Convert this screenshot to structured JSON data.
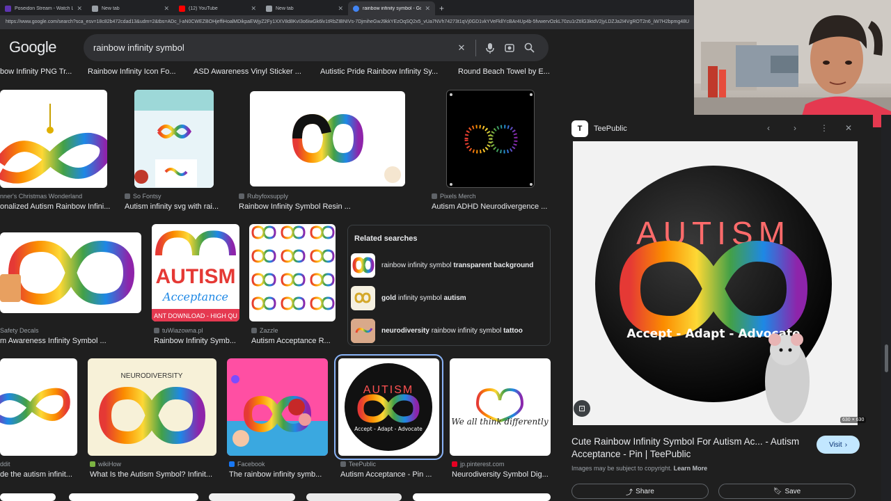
{
  "tabs": [
    {
      "title": "Poseidon Stream - Watch Live",
      "color": "#5e35b1"
    },
    {
      "title": "New tab",
      "color": "#9aa0a6"
    },
    {
      "title": "(12) YouTube",
      "color": "#ff0000"
    },
    {
      "title": "New tab",
      "color": "#9aa0a6"
    },
    {
      "title": "rainbow infinity symbol - Google",
      "color": "#4285f4",
      "active": true
    }
  ],
  "url": "https://www.google.com/search?sca_esv=18c82b472cdad13&udm=2&tbs=ADc_l-aN0CWEZBOHjeffiHoalMDikpaEWjyZ2Fy1XXV8d8KvI3o6iwGk6lv1tRbZIBNIVs-7DjmiheGwJ9kkYEzOqSQ2x5_vUa7NVh74273t1qVj0GD1vkYVeFkllYcBAr4Up4b-5fvwervOzkL70zu1rZtIlG3ktdV2jyLDZJa2I4VgROT2n6_iW7H2bpmg48U",
  "logo": "Google",
  "search": {
    "query": "rainbow infinity symbol"
  },
  "chips": [
    "bow Infinity PNG Tr...",
    "Rainbow Infinity Icon Fo...",
    "ASD Awareness Vinyl Sticker ...",
    "Autistic Pride Rainbow Infinity Sy...",
    "Round Beach Towel by E..."
  ],
  "row1": [
    {
      "source": "nner's Christmas Wonderland",
      "title": "onalized Autism Rainbow Infini..."
    },
    {
      "source": "So Fontsy",
      "title": "Autism infinity svg with rai..."
    },
    {
      "source": "Rubyfoxsupply",
      "title": "Rainbow Infinity Symbol Resin ..."
    },
    {
      "source": "Pixels Merch",
      "title": "Autism ADHD Neurodivergence ..."
    }
  ],
  "row2": [
    {
      "source": "Safety Decals",
      "title": "m Awareness Infinity Symbol ..."
    },
    {
      "source": "tuWiazowna.pl",
      "title": "Rainbow Infinity Symb..."
    },
    {
      "source": "Zazzle",
      "title": "Autism Acceptance R..."
    }
  ],
  "row2_images": {
    "autism_word": "AUTISM",
    "acceptance_word": "Acceptance",
    "banner": "ANT DOWNLOAD - HIGH QU"
  },
  "related": {
    "heading": "Related searches",
    "items": [
      {
        "plain": "rainbow infinity symbol ",
        "bold": "transparent background"
      },
      {
        "bold_pre": "gold",
        "plain": " infinity symbol ",
        "bold": "autism"
      },
      {
        "bold_pre": "neurodiversity",
        "plain": " rainbow infinity symbol ",
        "bold": "tattoo"
      }
    ]
  },
  "row3": [
    {
      "source": "ddit",
      "title": "de the autism infinit..."
    },
    {
      "source": "wikiHow",
      "title": "What Is the Autism Symbol? Infinit..."
    },
    {
      "source": "Facebook",
      "title": "The rainbow infinity symb..."
    },
    {
      "source": "TeePublic",
      "title": "Autism Acceptance - Pin ..."
    },
    {
      "source": "jp.pinterest.com",
      "title": "Neurodiversity Symbol Dig..."
    }
  ],
  "row3_images": {
    "neuro_label": "NEURODIVERSITY",
    "autism_pin": "AUTISM",
    "pin_slogan": "Accept - Adapt - Advocate",
    "think_text": "We all think differently"
  },
  "panel": {
    "site": "TeePublic",
    "image_top": "AUTISM",
    "image_bottom": "Accept - Adapt - Advocate",
    "dims": "630 × 630",
    "title": "Cute Rainbow Infinity Symbol For Autism Ac... - Autism Acceptance - Pin | TeePublic",
    "note": "Images may be subject to copyright.",
    "learn_more": "Learn More",
    "visit": "Visit",
    "share": "Share",
    "save": "Save"
  }
}
